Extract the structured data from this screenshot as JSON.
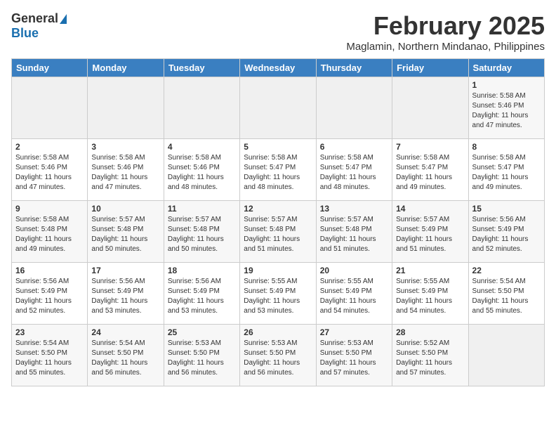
{
  "header": {
    "logo_general": "General",
    "logo_blue": "Blue",
    "title": "February 2025",
    "location": "Maglamin, Northern Mindanao, Philippines"
  },
  "days_of_week": [
    "Sunday",
    "Monday",
    "Tuesday",
    "Wednesday",
    "Thursday",
    "Friday",
    "Saturday"
  ],
  "weeks": [
    [
      {
        "day": "",
        "info": ""
      },
      {
        "day": "",
        "info": ""
      },
      {
        "day": "",
        "info": ""
      },
      {
        "day": "",
        "info": ""
      },
      {
        "day": "",
        "info": ""
      },
      {
        "day": "",
        "info": ""
      },
      {
        "day": "1",
        "info": "Sunrise: 5:58 AM\nSunset: 5:46 PM\nDaylight: 11 hours and 47 minutes."
      }
    ],
    [
      {
        "day": "2",
        "info": "Sunrise: 5:58 AM\nSunset: 5:46 PM\nDaylight: 11 hours and 47 minutes."
      },
      {
        "day": "3",
        "info": "Sunrise: 5:58 AM\nSunset: 5:46 PM\nDaylight: 11 hours and 47 minutes."
      },
      {
        "day": "4",
        "info": "Sunrise: 5:58 AM\nSunset: 5:46 PM\nDaylight: 11 hours and 48 minutes."
      },
      {
        "day": "5",
        "info": "Sunrise: 5:58 AM\nSunset: 5:47 PM\nDaylight: 11 hours and 48 minutes."
      },
      {
        "day": "6",
        "info": "Sunrise: 5:58 AM\nSunset: 5:47 PM\nDaylight: 11 hours and 48 minutes."
      },
      {
        "day": "7",
        "info": "Sunrise: 5:58 AM\nSunset: 5:47 PM\nDaylight: 11 hours and 49 minutes."
      },
      {
        "day": "8",
        "info": "Sunrise: 5:58 AM\nSunset: 5:47 PM\nDaylight: 11 hours and 49 minutes."
      }
    ],
    [
      {
        "day": "9",
        "info": "Sunrise: 5:58 AM\nSunset: 5:48 PM\nDaylight: 11 hours and 49 minutes."
      },
      {
        "day": "10",
        "info": "Sunrise: 5:57 AM\nSunset: 5:48 PM\nDaylight: 11 hours and 50 minutes."
      },
      {
        "day": "11",
        "info": "Sunrise: 5:57 AM\nSunset: 5:48 PM\nDaylight: 11 hours and 50 minutes."
      },
      {
        "day": "12",
        "info": "Sunrise: 5:57 AM\nSunset: 5:48 PM\nDaylight: 11 hours and 51 minutes."
      },
      {
        "day": "13",
        "info": "Sunrise: 5:57 AM\nSunset: 5:48 PM\nDaylight: 11 hours and 51 minutes."
      },
      {
        "day": "14",
        "info": "Sunrise: 5:57 AM\nSunset: 5:49 PM\nDaylight: 11 hours and 51 minutes."
      },
      {
        "day": "15",
        "info": "Sunrise: 5:56 AM\nSunset: 5:49 PM\nDaylight: 11 hours and 52 minutes."
      }
    ],
    [
      {
        "day": "16",
        "info": "Sunrise: 5:56 AM\nSunset: 5:49 PM\nDaylight: 11 hours and 52 minutes."
      },
      {
        "day": "17",
        "info": "Sunrise: 5:56 AM\nSunset: 5:49 PM\nDaylight: 11 hours and 53 minutes."
      },
      {
        "day": "18",
        "info": "Sunrise: 5:56 AM\nSunset: 5:49 PM\nDaylight: 11 hours and 53 minutes."
      },
      {
        "day": "19",
        "info": "Sunrise: 5:55 AM\nSunset: 5:49 PM\nDaylight: 11 hours and 53 minutes."
      },
      {
        "day": "20",
        "info": "Sunrise: 5:55 AM\nSunset: 5:49 PM\nDaylight: 11 hours and 54 minutes."
      },
      {
        "day": "21",
        "info": "Sunrise: 5:55 AM\nSunset: 5:49 PM\nDaylight: 11 hours and 54 minutes."
      },
      {
        "day": "22",
        "info": "Sunrise: 5:54 AM\nSunset: 5:50 PM\nDaylight: 11 hours and 55 minutes."
      }
    ],
    [
      {
        "day": "23",
        "info": "Sunrise: 5:54 AM\nSunset: 5:50 PM\nDaylight: 11 hours and 55 minutes."
      },
      {
        "day": "24",
        "info": "Sunrise: 5:54 AM\nSunset: 5:50 PM\nDaylight: 11 hours and 56 minutes."
      },
      {
        "day": "25",
        "info": "Sunrise: 5:53 AM\nSunset: 5:50 PM\nDaylight: 11 hours and 56 minutes."
      },
      {
        "day": "26",
        "info": "Sunrise: 5:53 AM\nSunset: 5:50 PM\nDaylight: 11 hours and 56 minutes."
      },
      {
        "day": "27",
        "info": "Sunrise: 5:53 AM\nSunset: 5:50 PM\nDaylight: 11 hours and 57 minutes."
      },
      {
        "day": "28",
        "info": "Sunrise: 5:52 AM\nSunset: 5:50 PM\nDaylight: 11 hours and 57 minutes."
      },
      {
        "day": "",
        "info": ""
      }
    ]
  ]
}
